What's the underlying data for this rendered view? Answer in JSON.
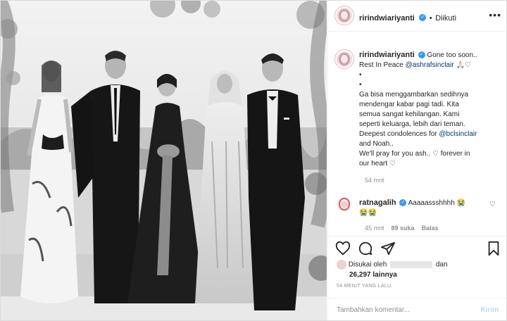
{
  "post": {
    "photo_alt": "",
    "header": {
      "username": "ririndwiariyanti",
      "dot": "•",
      "follow_label": "Diikuti",
      "more_label": "•••"
    },
    "caption": {
      "username": "ririndwiariyanti",
      "lines": [
        "Gone too soon..",
        "Rest In Peace",
        "•",
        "•",
        "Ga bisa menggambarkan sedihnya",
        "mendengar kabar pagi tadi. Kita",
        "semua sangat kehilangan. Kami",
        "seperti keluarga, lebih dari teman.",
        "Deepest condolences for",
        "and Noah..",
        "We'll pray for you ash..",
        "forever in",
        "our heart"
      ],
      "mention_1": "@ashrafsinclair",
      "mention_2": "@bclsinclair",
      "time": "54 mnt"
    },
    "comment": {
      "username": "ratnagalih",
      "text": "Aaaaassshhhh",
      "time": "45 mnt",
      "likes": "89 suka",
      "reply": "Balas"
    },
    "likes": {
      "prefix": "Disukai oleh",
      "suffix": "dan",
      "count": "26,297 lainnya"
    },
    "ago": "54 MENIT YANG LALU",
    "add_comment": {
      "placeholder": "Tambahkan komentar...",
      "send": "Kirim"
    },
    "icons": {
      "verified": "verified-badge-icon",
      "like": "heart-icon",
      "comment": "comment-icon",
      "share": "share-icon",
      "save": "bookmark-icon"
    },
    "colors": {
      "link": "#00376b",
      "verified": "#3897f0",
      "send_disabled": "#b2dffc",
      "muted": "#8e8e8e"
    }
  }
}
